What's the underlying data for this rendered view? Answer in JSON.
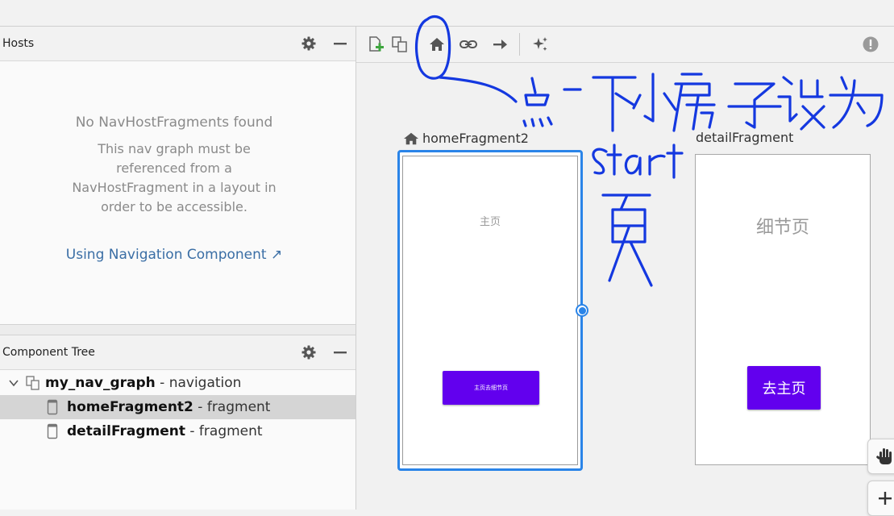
{
  "hosts": {
    "title": "Hosts",
    "message_title": "No NavHostFragments found",
    "message_body": "This nav graph must be referenced from a NavHostFragment in a layout in order to be accessible.",
    "link_label": "Using Navigation Component ↗"
  },
  "component_tree": {
    "title": "Component Tree",
    "rows": [
      {
        "name": "my_nav_graph",
        "type": " - navigation"
      },
      {
        "name": "homeFragment2",
        "type": " - fragment"
      },
      {
        "name": "detailFragment",
        "type": " - fragment"
      }
    ]
  },
  "canvas": {
    "fragments": [
      {
        "label": "homeFragment2",
        "screen_title": "主页",
        "button_label": "主页去细节页"
      },
      {
        "label": "detailFragment",
        "screen_title": "细节页",
        "button_label": "去主页"
      }
    ]
  },
  "colors": {
    "accent": "#2a84e8",
    "button": "#6200ee",
    "annotation_ink": "#1438e0"
  },
  "icons": {
    "panel_actions": [
      "gear-icon",
      "minimize-icon"
    ],
    "toolbar": [
      "new-destination-icon",
      "nested-graph-icon",
      "start-destination-home-icon",
      "deeplink-icon",
      "action-arrow-icon",
      "auto-arrange-icon",
      "warning-icon"
    ],
    "canvas_side": [
      "pan-hand-icon",
      "zoom-in-icon"
    ]
  }
}
